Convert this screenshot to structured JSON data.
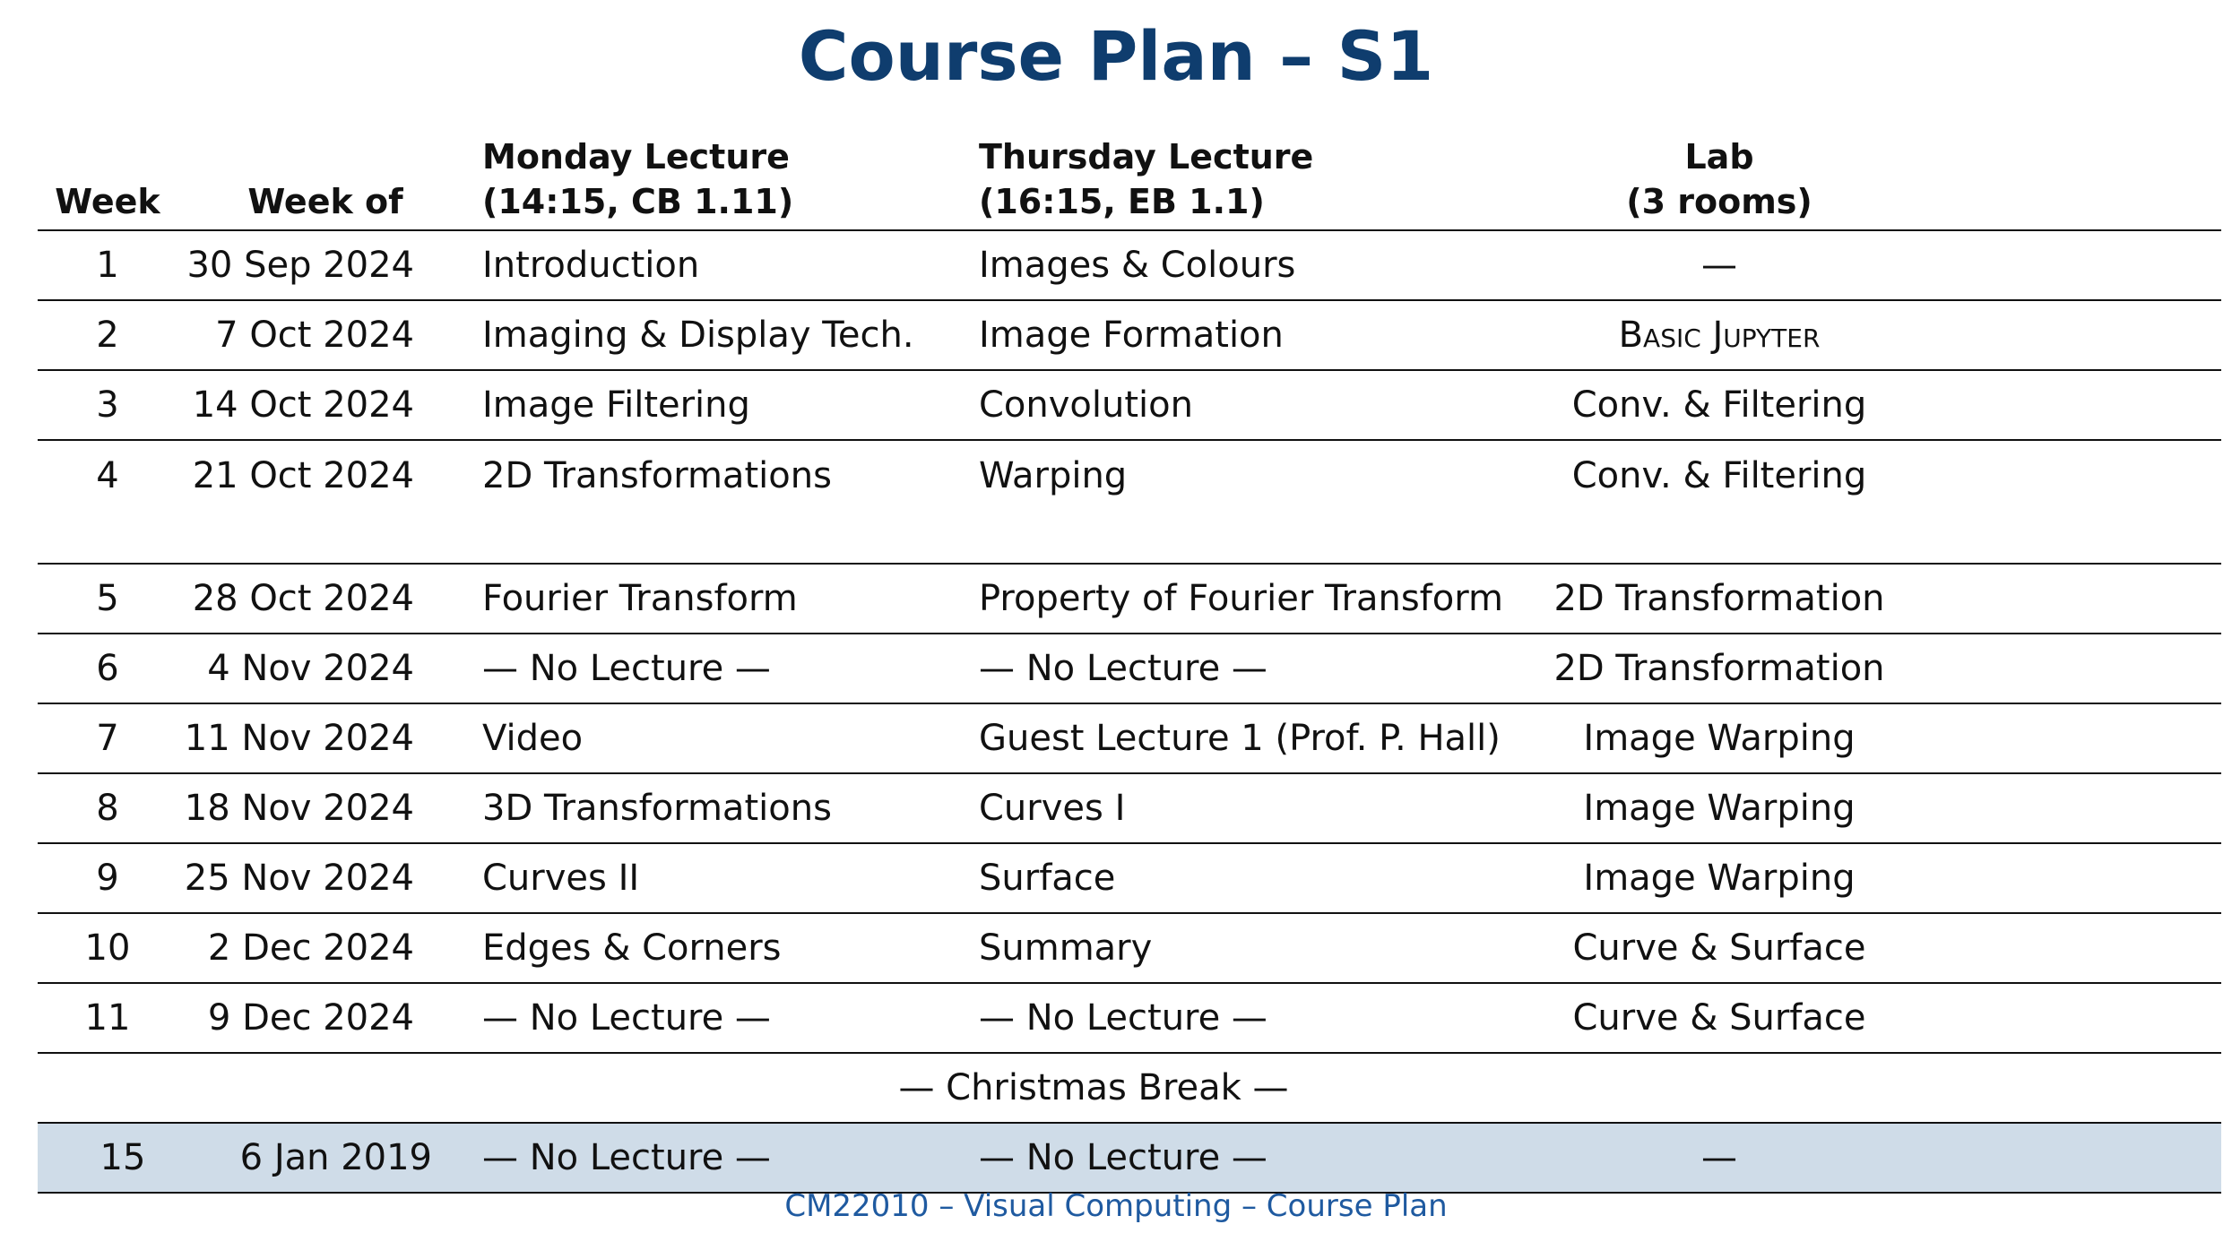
{
  "title": "Course Plan – S1",
  "headers": {
    "week": "Week",
    "week_of": "Week of",
    "monday_line1": "Monday Lecture",
    "monday_line2": "(14:15, CB 1.11)",
    "thursday_line1": "Thursday Lecture",
    "thursday_line2": "(16:15, EB 1.1)",
    "lab_line1": "Lab",
    "lab_line2": "(3 rooms)"
  },
  "rows": [
    {
      "week": "1",
      "date": "30 Sep 2024",
      "monday": "Introduction",
      "thursday": "Images & Colours",
      "lab": "—"
    },
    {
      "week": "2",
      "date": "7 Oct 2024",
      "monday": "Imaging & Display Tech.",
      "thursday": "Image Formation",
      "lab": "Basic Jupyter"
    },
    {
      "week": "3",
      "date": "14 Oct 2024",
      "monday": "Image Filtering",
      "thursday": "Convolution",
      "lab": "Conv. & Filtering"
    },
    {
      "week": "4",
      "date": "21 Oct 2024",
      "monday": "2D Transformations",
      "thursday": "Warping",
      "lab": "Conv. & Filtering"
    },
    {
      "week": "5",
      "date": "28 Oct 2024",
      "monday": "Fourier Transform",
      "thursday": "Property of Fourier Transform",
      "lab": "2D Transformation"
    },
    {
      "week": "6",
      "date": "4 Nov 2024",
      "monday": "— No Lecture —",
      "thursday": "— No Lecture —",
      "lab": "2D Transformation"
    },
    {
      "week": "7",
      "date": "11 Nov 2024",
      "monday": "Video",
      "thursday": "Guest Lecture 1 (Prof. P. Hall)",
      "lab": "Image Warping"
    },
    {
      "week": "8",
      "date": "18 Nov 2024",
      "monday": "3D Transformations",
      "thursday": "Curves I",
      "lab": "Image Warping"
    },
    {
      "week": "9",
      "date": "25 Nov 2024",
      "monday": "Curves II",
      "thursday": "Surface",
      "lab": "Image Warping"
    },
    {
      "week": "10",
      "date": "2 Dec 2024",
      "monday": "Edges & Corners",
      "thursday": "Summary",
      "lab": "Curve & Surface"
    },
    {
      "week": "11",
      "date": "9 Dec 2024",
      "monday": "— No Lecture —",
      "thursday": "— No Lecture —",
      "lab": "Curve & Surface"
    }
  ],
  "break_row": "— Christmas Break —",
  "last_row": {
    "week": "15",
    "date": "6 Jan 2019",
    "monday": "— No Lecture —",
    "thursday": "— No Lecture —",
    "lab": "—"
  },
  "colors": {
    "title": "#0f3d6e",
    "highlight": "#cfdce8",
    "footer": "#1f5aa0"
  },
  "footer": "CM22010 – Visual Computing – Course Plan"
}
